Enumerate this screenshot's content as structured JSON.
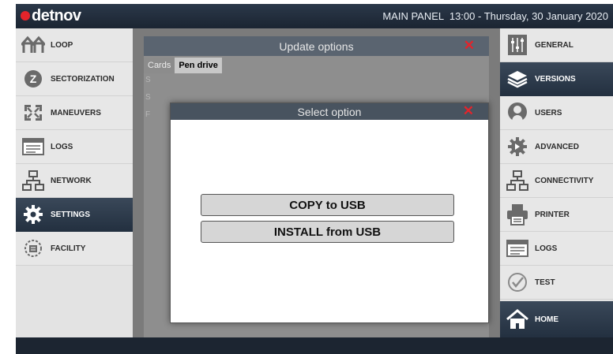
{
  "header": {
    "brand": "detnov",
    "info": "MAIN PANEL  13:00 - Thursday, 30 January 2020",
    "colors": {
      "header_bg": "#1e2835",
      "logo_dot": "#e3242b"
    }
  },
  "left_nav": [
    {
      "label": "LOOP",
      "icon": "loop-icon",
      "active": false
    },
    {
      "label": "SECTORIZATION",
      "icon": "sectorization-icon",
      "active": false
    },
    {
      "label": "MANEUVERS",
      "icon": "maneuvers-icon",
      "active": false
    },
    {
      "label": "LOGS",
      "icon": "logs-icon",
      "active": false
    },
    {
      "label": "NETWORK",
      "icon": "network-icon",
      "active": false
    },
    {
      "label": "SETTINGS",
      "icon": "gear-icon",
      "active": true
    },
    {
      "label": "FACILITY",
      "icon": "facility-icon",
      "active": false
    }
  ],
  "right_nav": [
    {
      "label": "GENERAL",
      "icon": "general-icon",
      "active": false
    },
    {
      "label": "VERSIONS",
      "icon": "versions-icon",
      "active": true
    },
    {
      "label": "USERS",
      "icon": "user-icon",
      "active": false
    },
    {
      "label": "ADVANCED",
      "icon": "advanced-icon",
      "active": false
    },
    {
      "label": "CONNECTIVITY",
      "icon": "connectivity-icon",
      "active": false
    },
    {
      "label": "PRINTER",
      "icon": "printer-icon",
      "active": false
    },
    {
      "label": "LOGS",
      "icon": "logs-icon",
      "active": false
    },
    {
      "label": "TEST",
      "icon": "test-icon",
      "active": false
    },
    {
      "label": "HOME",
      "icon": "home-icon",
      "active": true
    }
  ],
  "update_dialog": {
    "title": "Update options",
    "close_glyph": "✕",
    "tabs": [
      "Cards",
      "Pen drive"
    ],
    "selected_tab": "Pen drive",
    "side_letters": [
      "S",
      "S",
      "F"
    ]
  },
  "select_dialog": {
    "title": "Select option",
    "close_glyph": "✕",
    "options": [
      "COPY to USB",
      "INSTALL from USB"
    ]
  }
}
